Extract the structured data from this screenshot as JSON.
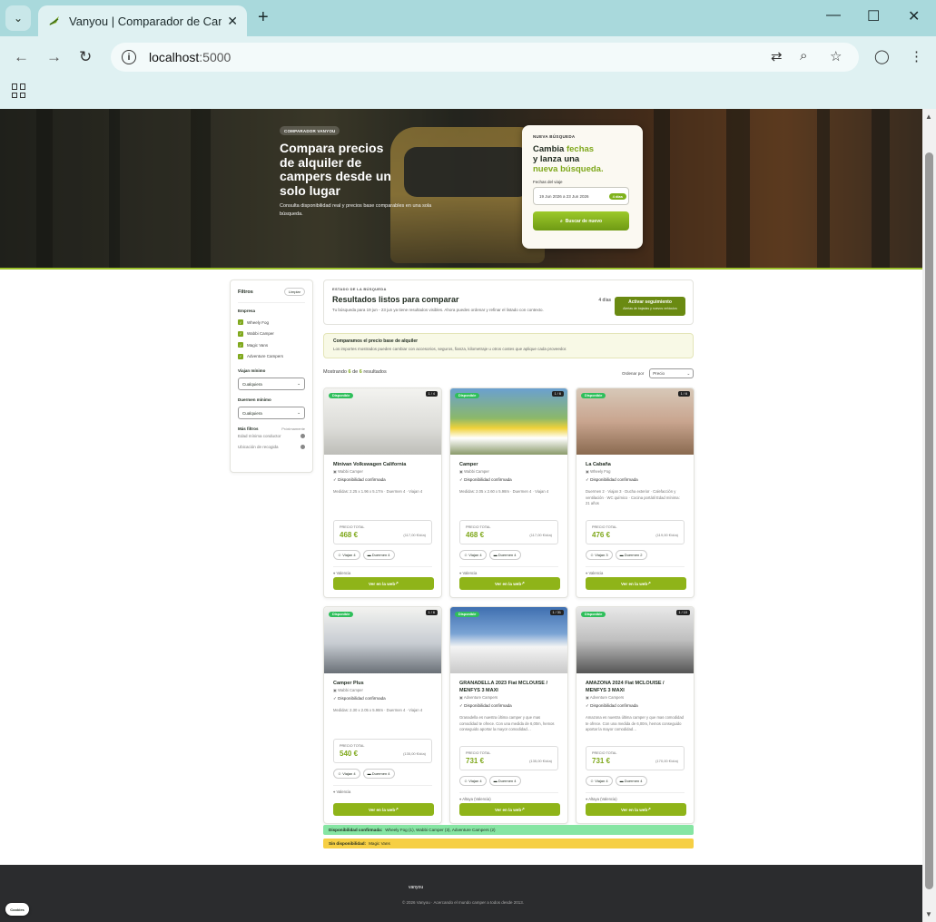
{
  "browser": {
    "tab_title": "Vanyou | Comparador de Camp",
    "url_host": "localhost",
    "url_port": ":5000"
  },
  "hero": {
    "badge": "COMPARADOR VANYOU",
    "title": "Compara precios de alquiler de campers desde un solo lugar",
    "subtitle": "Consulta disponibilidad real y precios base comparables en una sola búsqueda."
  },
  "search": {
    "kicker": "NUEVA BÚSQUEDA",
    "line1a": "Cambia ",
    "line1b": "fechas",
    "line2": "y lanza una",
    "line3": "nueva búsqueda.",
    "dates_label": "Fechas del viaje",
    "dates_value": "19 Jun 2026 a 23 Jun 2026",
    "nights": "4 días",
    "button": "Buscar de nuevo"
  },
  "filters": {
    "title": "Filtros",
    "clear": "Limpiar",
    "company_label": "Empresa",
    "companies": [
      "Wheely Fog",
      "Wabbi Camper",
      "Magic Vans",
      "Adventure Campers"
    ],
    "travel_label": "Viajan mínimo",
    "travel_value": "Cualquiera",
    "sleep_label": "Duermen mínimo",
    "sleep_value": "Cualquiera",
    "more_label": "Más filtros",
    "more_right": "Próximamente",
    "options": [
      "Edad mínima conductor",
      "Ubicación de recogida"
    ]
  },
  "status": {
    "kicker": "ESTADO DE LA BÚSQUEDA",
    "title": "Resultados listos para comparar",
    "desc": "Tu búsqueda para 19 jun - 23 jun ya tiene resultados visibles. Ahora puedes ordenar y refinar el listado con contexto.",
    "days": "4 días",
    "track": "Activar seguimiento",
    "track_sub": "Alertas de bajadas y nuevos vehículos"
  },
  "note": {
    "title": "Comparamos el precio base de alquiler",
    "desc": "Los importes mostrados pueden cambiar con accesorios, seguros, fianza, kilometraje u otros costes que aplique cada proveedor."
  },
  "results": {
    "showing_a": "Mostrando ",
    "shown": "6",
    "showing_b": " de ",
    "total": "6",
    "showing_c": " resultados",
    "sort_label": "Ordenar por",
    "sort_value": "Precio"
  },
  "cards": [
    {
      "avail": "Disponible",
      "idx": "1 / 4",
      "name": "Minivan Volkswagen California",
      "company": "Wabbi Camper",
      "ok": "Disponibilidad confirmada",
      "desc": "Medidas: 2.25 x 1.96 x 5.17m · Duermen 4 · Viajan 4",
      "price_label": "PRECIO TOTAL",
      "price": "468 €",
      "per_day": "(117,00 €/día)",
      "chip1": "Viajan 4",
      "chip2": "Duermen 4",
      "loc": "Valencia",
      "cta": "Ver en la web"
    },
    {
      "avail": "Disponible",
      "idx": "1 / 6",
      "name": "Camper",
      "company": "Wabbi Camper",
      "ok": "Disponibilidad confirmada",
      "desc": "Medidas: 2.05 x 2.60 x 5.98m · Duermen 4 · Viajan 4",
      "price_label": "PRECIO TOTAL",
      "price": "468 €",
      "per_day": "(117,00 €/día)",
      "chip1": "Viajan 4",
      "chip2": "Duermen 4",
      "loc": "Valencia",
      "cta": "Ver en la web"
    },
    {
      "avail": "Disponible",
      "idx": "1 / 6",
      "name": "La Cabaña",
      "company": "Wheely Fog",
      "ok": "Disponibilidad confirmada",
      "desc": "Duermen 2 · Viajan 3 · Ducha exterior · Calefacción y ventilación · WC químico · Cocina portátil Edad mínima: 21 años",
      "price_label": "PRECIO TOTAL",
      "price": "476 €",
      "per_day": "(119,00 €/día)",
      "chip1": "Viajan 3",
      "chip2": "Duermen 2",
      "loc": "Valencia",
      "cta": "Ver en la web"
    },
    {
      "avail": "Disponible",
      "idx": "1 / 6",
      "name": "Camper Plus",
      "company": "Wabbi Camper",
      "ok": "Disponibilidad confirmada",
      "desc": "Medidas: 2.30 x 2.05 x 5.98m · Duermen 4 · Viajan 4",
      "price_label": "PRECIO TOTAL",
      "price": "540 €",
      "per_day": "(135,00 €/día)",
      "chip1": "Viajan 4",
      "chip2": "Duermen 4",
      "loc": "Valencia",
      "cta": "Ver en la web"
    },
    {
      "avail": "Disponible",
      "idx": "1 / 31",
      "name": "GRANADELLA 2023 Fiat MCLOUISE / MENFYS 3 MAXI",
      "company": "Adventure Campers",
      "ok": "Disponibilidad confirmada",
      "desc": "Granadella es nuestra última camper y que mas comodidad te ofrece. Con una medida de 6,00m, hemos conseguido aportar la mayor comodidad…",
      "price_label": "PRECIO TOTAL",
      "price": "731 €",
      "per_day": "(135,00 €/día)",
      "chip1": "Viajan 4",
      "chip2": "Duermen 4",
      "loc": "Altaya (Valencia)",
      "cta": "Ver en la web"
    },
    {
      "avail": "Disponible",
      "idx": "1 / 10",
      "name": "AMAZONA 2024 Fiat MCLOUISE / MENFYS 3 MAXI",
      "company": "Adventure Campers",
      "ok": "Disponibilidad confirmada",
      "desc": "Amazona es nuestra última camper y que mas comodidad te ofrece. Con una medida de 6,00m, hemos conseguido aportar la mayor comodidad…",
      "price_label": "PRECIO TOTAL",
      "price": "731 €",
      "per_day": "(170,00 €/día)",
      "chip1": "Viajan 4",
      "chip2": "Duermen 4",
      "loc": "Altaya (Valencia)",
      "cta": "Ver en la web"
    }
  ],
  "legend": {
    "ok_label": "Disponibilidad confirmada:",
    "ok_value": "Wheely Fog (1), Wabbi Camper (3), Adventure Campers (2)",
    "no_label": "Sin disponibilidad:",
    "no_value": "Magic Vans"
  },
  "footer": {
    "logo": "vanyou",
    "copyright": "© 2026 Vanyou · Acercando el mundo camper a todos desde 2013."
  },
  "cookies": "Cookies",
  "colors": {
    "accent": "#7fa81c",
    "available": "#2fbf5b",
    "footer": "#2b2c2e"
  }
}
